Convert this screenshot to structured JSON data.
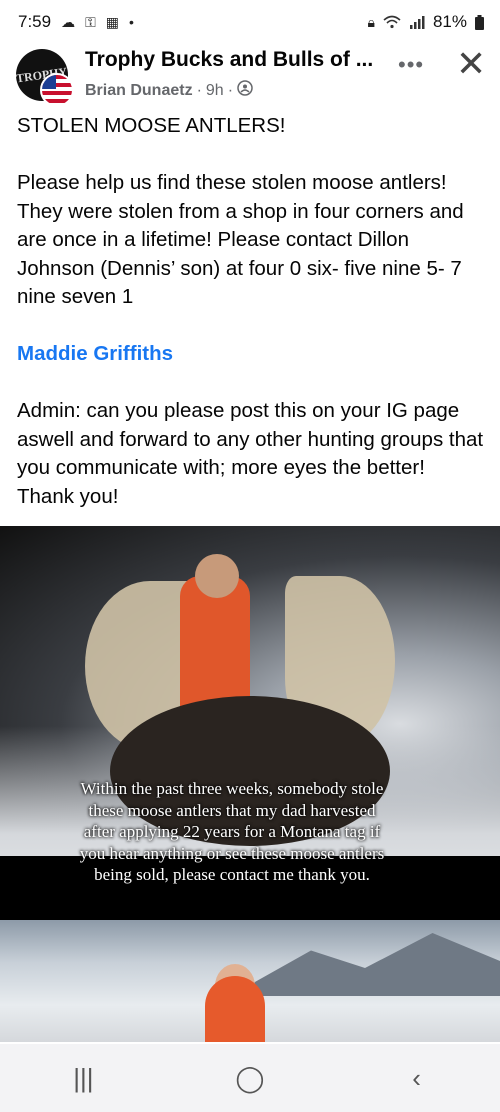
{
  "status_bar": {
    "time": "7:59",
    "battery": "81%",
    "icons_left": [
      "cloud-icon",
      "key-icon",
      "calendar-icon",
      "dot-icon"
    ],
    "icons_right": [
      "lock-icon",
      "wifi-icon",
      "signal-icon",
      "battery-icon"
    ]
  },
  "header": {
    "page_name": "Trophy Bucks and Bulls of ...",
    "author": "Brian Dunaetz",
    "time": "9h",
    "separator": "·",
    "more_label": "•••",
    "close_label": "✕"
  },
  "post": {
    "line1": "STOLEN MOOSE ANTLERS!",
    "line2": "Please help us find these stolen moose antlers! They were stolen from a shop in four corners and are once in a lifetime! Please contact Dillon Johnson (Dennis’ son) at four 0 six- five nine 5- 7 nine seven 1",
    "mention": "Maddie Griffiths",
    "line3": "Admin: can you please post this on your IG page aswell and forward to any other hunting groups that you communicate with; more eyes the better!  Thank you!"
  },
  "photo": {
    "caption": "Within the past three weeks, somebody stole these moose antlers that my dad harvested after applying 22 years for a Montana tag if you hear anything or see these moose antlers being sold, please contact me thank you."
  },
  "nav": {
    "recents": "|||",
    "home": "◯",
    "back": "‹"
  }
}
